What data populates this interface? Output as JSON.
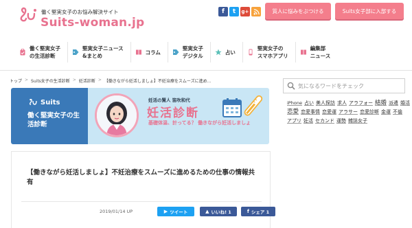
{
  "header": {
    "tagline": "働く堅実女子のお悩み解決サイト",
    "logo_text": "Suits-woman.jp",
    "social": [
      "f",
      "t",
      "g+",
      "rss"
    ],
    "ask_button": "質人に悩みをぶつける",
    "join_button": "Suits女子部に入部する"
  },
  "nav": {
    "items": [
      {
        "label": "働く堅実女子\nの生活診断",
        "icon": "clipboard-icon"
      },
      {
        "label": "堅実女子ニュース\n&まとめ",
        "icon": "tag-icon"
      },
      {
        "label": "コラム",
        "icon": "book-icon"
      },
      {
        "label": "堅実女子\nデジタル",
        "icon": "tag-icon"
      },
      {
        "label": "占い",
        "icon": "star-icon"
      },
      {
        "label": "堅実女子の\nスマホアプリ",
        "icon": "smartphone-icon"
      },
      {
        "label": "編集部\nニュース",
        "icon": "book-icon"
      }
    ]
  },
  "breadcrumb": [
    "トップ",
    "Suits女子の生活診断",
    "妊活診断",
    "【働きながら妊活しましょ】不妊治療をスムーズに進め..."
  ],
  "banner": {
    "logo": "Suits",
    "slogan": "働く堅実女子の生活診断",
    "caption": "妊活の賢人 笛吹和代",
    "title": "妊活診断",
    "subtitle": "基礎体温、計ってる？ 働きながら妊活しましょ"
  },
  "article": {
    "title": "【働きながら妊活しましょ】不妊治療をスムーズに進めるための仕事の情報共有",
    "date": "2019/01/14 UP",
    "tweet_label": "ツイート",
    "like_label": "いいね! 1",
    "share_label": "シェア 1"
  },
  "search": {
    "placeholder": "気になるワードをチェック"
  },
  "tags": [
    {
      "text": "iPhone",
      "size": "sm"
    },
    {
      "text": "占い",
      "size": ""
    },
    {
      "text": "美人探訪",
      "size": ""
    },
    {
      "text": "求人",
      "size": ""
    },
    {
      "text": "アラフォー",
      "size": ""
    },
    {
      "text": "結婚",
      "size": "lg"
    },
    {
      "text": "派遣",
      "size": ""
    },
    {
      "text": "婚活",
      "size": ""
    },
    {
      "text": "恋愛",
      "size": "lg"
    },
    {
      "text": "恋愛事情",
      "size": ""
    },
    {
      "text": "恋愛運",
      "size": ""
    },
    {
      "text": "アラサー",
      "size": ""
    },
    {
      "text": "恋愛診断",
      "size": ""
    },
    {
      "text": "金運",
      "size": ""
    },
    {
      "text": "不倫",
      "size": ""
    },
    {
      "text": "アプリ",
      "size": ""
    },
    {
      "text": "妊活",
      "size": ""
    },
    {
      "text": "セカンド",
      "size": ""
    },
    {
      "text": "運勢",
      "size": ""
    },
    {
      "text": "雑誌女子",
      "size": ""
    }
  ],
  "colors": {
    "brand_pink": "#e8728f",
    "button_pink": "#f47e8c",
    "banner_blue": "#3a79b8",
    "banner_light": "#c9e6f5",
    "twitter": "#1da1f2",
    "facebook": "#3b5998"
  }
}
